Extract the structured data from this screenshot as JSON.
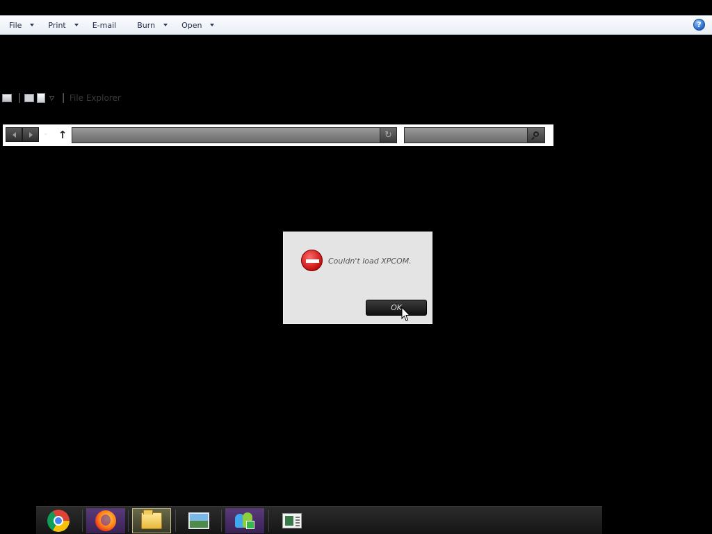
{
  "menubar": {
    "items": [
      {
        "label": "File",
        "has_caret": true
      },
      {
        "label": "Print",
        "has_caret": true
      },
      {
        "label": "E-mail",
        "has_caret": false
      },
      {
        "label": "Burn",
        "has_caret": true
      },
      {
        "label": "Open",
        "has_caret": true
      }
    ],
    "help_label": "?"
  },
  "quick_access": {
    "title": "File Explorer",
    "icons": [
      "properties-icon",
      "new-folder-icon",
      "customize-icon"
    ]
  },
  "navbar": {
    "address_value": "",
    "search_value": "",
    "icons": [
      "back-arrow-icon",
      "forward-arrow-icon",
      "recent-locations-icon",
      "up-arrow-icon",
      "refresh-icon",
      "search-icon"
    ]
  },
  "dialog": {
    "message": "Couldn't load XPCOM.",
    "ok_label": "OK",
    "icon": "error-stop-icon"
  },
  "taskbar": {
    "apps": [
      "chrome-icon",
      "firefox-icon",
      "file-explorer-icon",
      "photo-viewer-icon",
      "messenger-icon",
      "document-viewer-icon"
    ]
  },
  "colors": {
    "background": "#000000",
    "menubar": "#eef2f8",
    "dialog": "#e4e4e4",
    "error_red": "#c41010"
  }
}
